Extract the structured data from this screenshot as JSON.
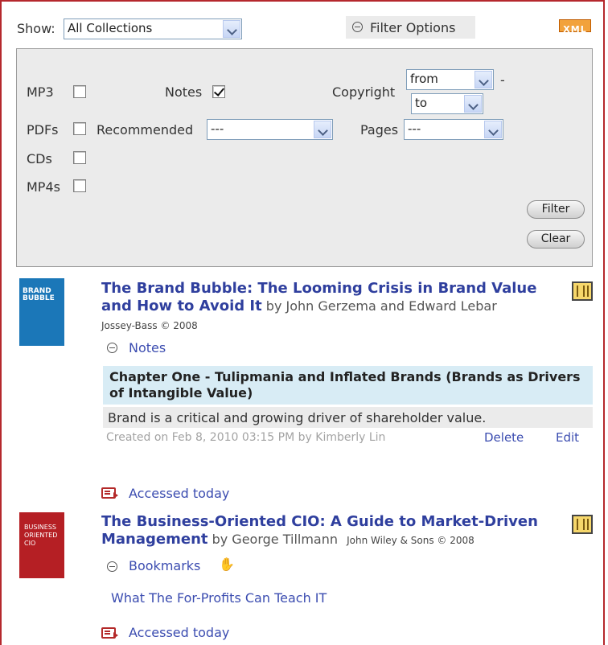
{
  "toolbar": {
    "show_label": "Show:",
    "show_value": "All Collections",
    "filter_options_label": "Filter Options",
    "xml_label": "XML"
  },
  "filters": {
    "mp3_label": "MP3",
    "pdfs_label": "PDFs",
    "cds_label": "CDs",
    "mp4s_label": "MP4s",
    "notes_label": "Notes",
    "notes_checked": true,
    "recommended_label": "Recommended",
    "recommended_value": "---",
    "copyright_label": "Copyright",
    "copyright_from": "from",
    "copyright_to": "to",
    "copyright_dash": "-",
    "pages_label": "Pages",
    "pages_value": "---",
    "filter_button": "Filter",
    "clear_button": "Clear"
  },
  "results": [
    {
      "title": "The Brand Bubble: The Looming Crisis in Brand Value and How to Avoid It",
      "by": "by John Gerzema and Edward Lebar",
      "publisher": "Jossey-Bass © 2008",
      "section_label": "Notes",
      "note_chapter": "Chapter One - Tulipmania and Inflated Brands (Brands as Drivers of Intangible Value)",
      "note_text": "Brand is a critical and growing driver of shareholder value.",
      "note_meta": "Created on Feb 8, 2010 03:15 PM by Kimberly Lin",
      "delete_label": "Delete",
      "edit_label": "Edit",
      "accessed": "Accessed today",
      "cover_text": "BRAND BUBBLE"
    },
    {
      "title": "The Business-Oriented CIO: A Guide to Market-Driven Management",
      "by": "by George Tillmann",
      "publisher": "John Wiley & Sons © 2008",
      "section_label": "Bookmarks",
      "bookmark_link": "What The For-Profits Can Teach IT",
      "accessed": "Accessed today",
      "cover_text": "BUSINESS ORIENTED CIO"
    }
  ],
  "colors": {
    "border": "#b5282d",
    "link": "#2f3f9e",
    "note_header_bg": "#d8ecf5",
    "panel_bg": "#ebebeb"
  }
}
